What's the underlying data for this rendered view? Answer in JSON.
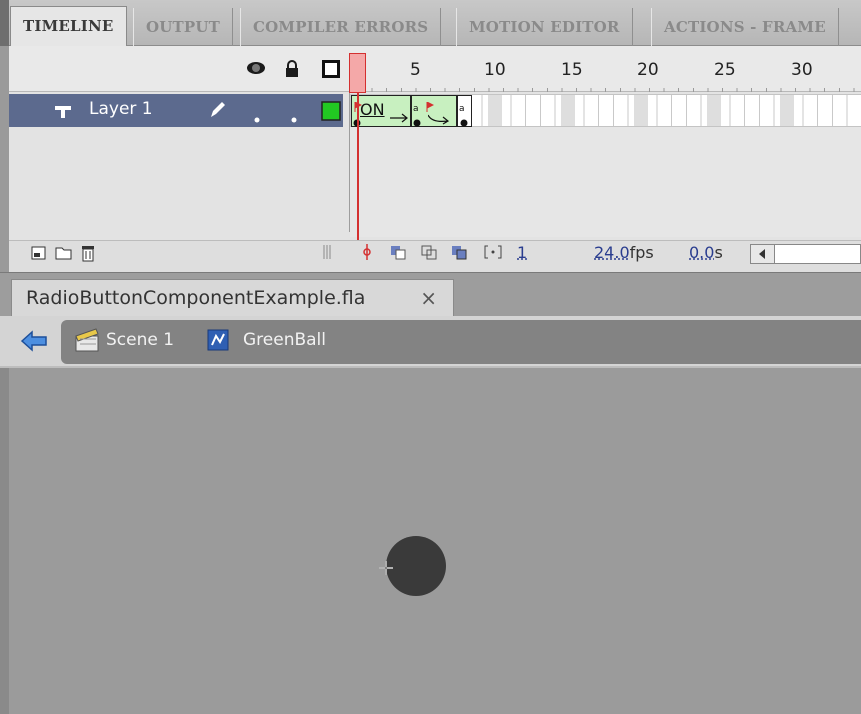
{
  "panel_tabs": [
    "TIMELINE",
    "OUTPUT",
    "COMPILER ERRORS",
    "MOTION EDITOR",
    "ACTIONS - FRAME"
  ],
  "timeline": {
    "frame_numbers": [
      "5",
      "10",
      "15",
      "20",
      "25",
      "30"
    ],
    "layer_name": "Layer 1",
    "frame_label": "ON",
    "footer": {
      "current_frame": "1",
      "fps_value": "24.0",
      "fps_unit": "fps",
      "time_value": "0.0",
      "time_unit": "s"
    }
  },
  "document": {
    "tab_title": "RadioButtonComponentExample.fla",
    "close_glyph": "×"
  },
  "breadcrumb": {
    "scene": "Scene 1",
    "symbol": "GreenBall"
  },
  "colors": {
    "layer_highlight": "#5c6a8e",
    "keyframe_fill": "#c8f0c0",
    "playhead": "#d43030",
    "layer_outline_color": "#22c922",
    "stage": "#9b9b9b"
  }
}
